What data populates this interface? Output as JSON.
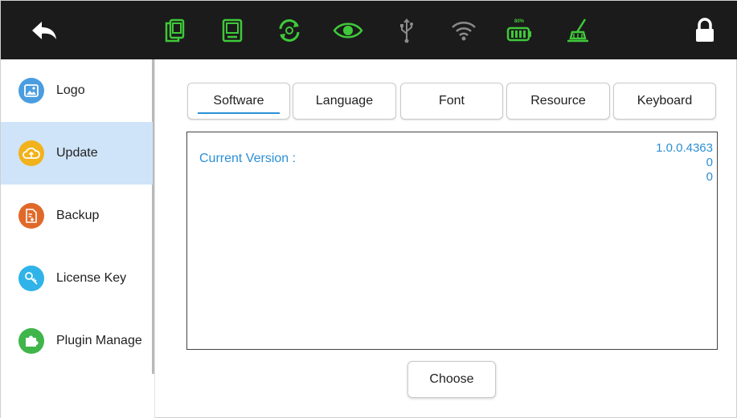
{
  "topbar": {
    "icons": [
      "back-arrow-icon",
      "copy-icon",
      "device-icon",
      "sync-icon",
      "eye-icon",
      "usb-icon",
      "wifi-icon",
      "battery-icon",
      "cleaning-icon",
      "lock-icon"
    ],
    "battery_label": "80%",
    "colors": {
      "background": "#1b1b1b",
      "accent": "#3fc93a",
      "muted": "#8a8a8a",
      "white": "#ffffff"
    }
  },
  "sidebar": {
    "items": [
      {
        "label": "Logo",
        "icon": "image-icon",
        "color": "#4a9de0"
      },
      {
        "label": "Update",
        "icon": "cloud-update-icon",
        "color": "#f2b21c",
        "active": true
      },
      {
        "label": "Backup",
        "icon": "backup-icon",
        "color": "#e0692a"
      },
      {
        "label": "License Key",
        "icon": "key-icon",
        "color": "#2fb3e8"
      },
      {
        "label": "Plugin Manage",
        "icon": "puzzle-icon",
        "color": "#3fb54a"
      }
    ]
  },
  "tabs": [
    {
      "label": "Software",
      "selected": true
    },
    {
      "label": "Language"
    },
    {
      "label": "Font"
    },
    {
      "label": "Resource"
    },
    {
      "label": "Keyboard"
    }
  ],
  "panel": {
    "key_label": "Current Version :",
    "values": [
      "1.0.0.4363",
      "0",
      "0"
    ]
  },
  "choose_label": "Choose",
  "colors": {
    "accent_blue": "#2b8fd6",
    "active_row": "#cfe4f8"
  }
}
